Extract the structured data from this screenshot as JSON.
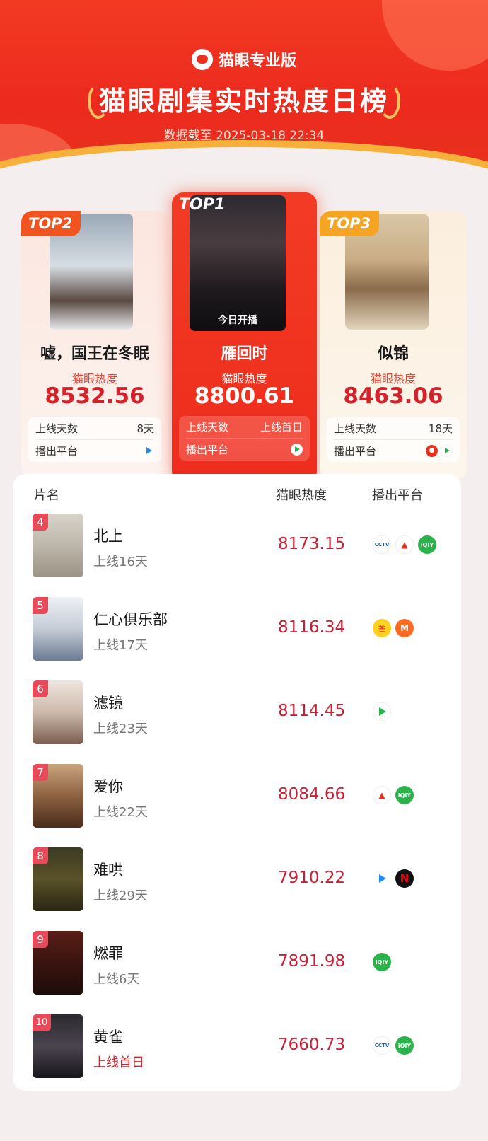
{
  "header": {
    "brand": "猫眼专业版",
    "title": "猫眼剧集实时热度日榜",
    "timestamp": "数据截至 2025-03-18 22:34"
  },
  "top3": {
    "heat_label": "猫眼热度",
    "days_label": "上线天数",
    "platform_label": "播出平台",
    "first": {
      "rank": "TOP1",
      "title": "雁回时",
      "score": "8800.61",
      "days": "上线首日",
      "poster_caption": "今日开播",
      "platforms": [
        "tencent-icon"
      ]
    },
    "second": {
      "rank": "TOP2",
      "title": "嘘，国王在冬眠",
      "score": "8532.56",
      "days": "8天",
      "platforms": [
        "youku-icon"
      ]
    },
    "third": {
      "rank": "TOP3",
      "title": "似锦",
      "score": "8463.06",
      "days": "18天",
      "platforms": [
        "drama-icon",
        "tencent-icon"
      ]
    }
  },
  "list": {
    "headers": {
      "name": "片名",
      "heat": "猫眼热度",
      "platform": "播出平台"
    },
    "rows": [
      {
        "rank": "4",
        "name": "北上",
        "days": "上线16天",
        "score": "8173.15",
        "platforms": [
          "cctv-icon",
          "bjtv-icon",
          "iqiyi-icon"
        ]
      },
      {
        "rank": "5",
        "name": "仁心俱乐部",
        "days": "上线17天",
        "score": "8116.34",
        "platforms": [
          "hunan-icon",
          "mgtv-icon"
        ]
      },
      {
        "rank": "6",
        "name": "滤镜",
        "days": "上线23天",
        "score": "8114.45",
        "platforms": [
          "tencent-icon"
        ]
      },
      {
        "rank": "7",
        "name": "爱你",
        "days": "上线22天",
        "score": "8084.66",
        "platforms": [
          "bjtv-icon",
          "iqiyi-icon"
        ]
      },
      {
        "rank": "8",
        "name": "难哄",
        "days": "上线29天",
        "score": "7910.22",
        "platforms": [
          "youku-icon",
          "netflix-icon"
        ]
      },
      {
        "rank": "9",
        "name": "燃罪",
        "days": "上线6天",
        "score": "7891.98",
        "platforms": [
          "iqiyi-icon"
        ]
      },
      {
        "rank": "10",
        "name": "黄雀",
        "days": "上线首日",
        "score": "7660.73",
        "platforms": [
          "cctv-icon",
          "iqiyi-icon"
        ]
      }
    ]
  },
  "colors": {
    "brand_red": "#e8321f",
    "score_red": "#c91f35",
    "rank_badge": "#e84a5a",
    "top2_tag": "#f2541f",
    "top3_tag": "#f5a523"
  }
}
